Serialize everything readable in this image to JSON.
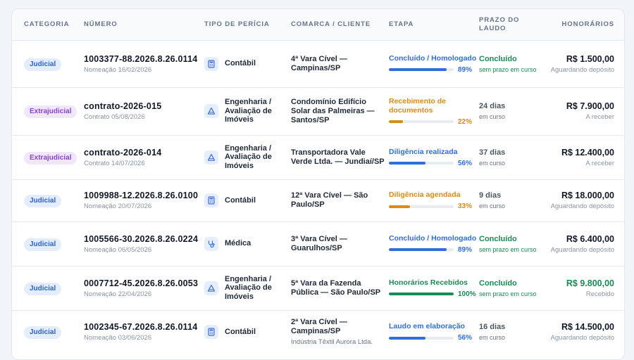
{
  "headers": {
    "categoria": "CATEGORIA",
    "numero": "NÚMERO",
    "tipo": "TIPO DE PERÍCIA",
    "comarca": "COMARCA / CLIENTE",
    "etapa": "ETAPA",
    "prazo_l1": "PRAZO DO",
    "prazo_l2": "LAUDO",
    "honorarios": "HONORÁRIOS"
  },
  "colors": {
    "blue": "#2f6fdc",
    "orange": "#dd8a15",
    "green": "#1a8a55",
    "gray": "#64748b",
    "bar_track": "#e8ecf1"
  },
  "rows": [
    {
      "categoria": "Judicial",
      "categoria_style": "judicial",
      "numero": "1003377-88.2026.8.26.0114",
      "sub": "Nomeação 16/02/2026",
      "tipo_icon": "calculator-icon",
      "tipo": "Contábil",
      "comarca": "4ª Vara Cível — Campinas/SP",
      "comarca_sub": "",
      "etapa": "Concluído / Homologado",
      "etapa_color": "blue",
      "progress": 89,
      "progress_label": "89%",
      "prazo": "Concluído",
      "prazo_sub": "sem prazo em curso",
      "prazo_style": "green",
      "valor": "R$ 1.500,00",
      "valor_sub": "Aguardando depósito",
      "valor_green": false
    },
    {
      "categoria": "Extrajudicial",
      "categoria_style": "extrajudicial",
      "numero": "contrato-2026-015",
      "sub": "Contrato 05/08/2026",
      "tipo_icon": "engineering-icon",
      "tipo": "Engenharia / Avaliação de Imóveis",
      "comarca": "Condomínio Edifício Solar das Palmeiras — Santos/SP",
      "comarca_sub": "",
      "etapa": "Recebimento de documentos",
      "etapa_color": "orange",
      "progress": 22,
      "progress_label": "22%",
      "prazo": "24 dias",
      "prazo_sub": "em curso",
      "prazo_style": "gray",
      "valor": "R$ 7.900,00",
      "valor_sub": "A receber",
      "valor_green": false
    },
    {
      "categoria": "Extrajudicial",
      "categoria_style": "extrajudicial",
      "numero": "contrato-2026-014",
      "sub": "Contrato 14/07/2026",
      "tipo_icon": "engineering-icon",
      "tipo": "Engenharia / Avaliação de Imóveis",
      "comarca": "Transportadora Vale Verde Ltda. — Jundiaí/SP",
      "comarca_sub": "",
      "etapa": "Diligência realizada",
      "etapa_color": "blue",
      "progress": 56,
      "progress_label": "56%",
      "prazo": "37 dias",
      "prazo_sub": "em curso",
      "prazo_style": "gray",
      "valor": "R$ 12.400,00",
      "valor_sub": "A receber",
      "valor_green": false
    },
    {
      "categoria": "Judicial",
      "categoria_style": "judicial",
      "numero": "1009988-12.2026.8.26.0100",
      "sub": "Nomeação 20/07/2026",
      "tipo_icon": "calculator-icon",
      "tipo": "Contábil",
      "comarca": "12ª Vara Cível — São Paulo/SP",
      "comarca_sub": "",
      "etapa": "Diligência agendada",
      "etapa_color": "orange",
      "progress": 33,
      "progress_label": "33%",
      "prazo": "9 dias",
      "prazo_sub": "em curso",
      "prazo_style": "gray",
      "valor": "R$ 18.000,00",
      "valor_sub": "Aguardando depósito",
      "valor_green": false
    },
    {
      "categoria": "Judicial",
      "categoria_style": "judicial",
      "numero": "1005566-30.2026.8.26.0224",
      "sub": "Nomeação 06/05/2026",
      "tipo_icon": "stethoscope-icon",
      "tipo": "Médica",
      "comarca": "3ª Vara Cível — Guarulhos/SP",
      "comarca_sub": "",
      "etapa": "Concluído / Homologado",
      "etapa_color": "blue",
      "progress": 89,
      "progress_label": "89%",
      "prazo": "Concluído",
      "prazo_sub": "sem prazo em curso",
      "prazo_style": "green",
      "valor": "R$ 6.400,00",
      "valor_sub": "Aguardando depósito",
      "valor_green": false
    },
    {
      "categoria": "Judicial",
      "categoria_style": "judicial",
      "numero": "0007712-45.2026.8.26.0053",
      "sub": "Nomeação 22/04/2026",
      "tipo_icon": "engineering-icon",
      "tipo": "Engenharia / Avaliação de Imóveis",
      "comarca": "5ª Vara da Fazenda Pública — São Paulo/SP",
      "comarca_sub": "",
      "etapa": "Honorários Recebidos",
      "etapa_color": "green",
      "progress": 100,
      "progress_label": "100%",
      "prazo": "Concluído",
      "prazo_sub": "sem prazo em curso",
      "prazo_style": "green",
      "valor": "R$ 9.800,00",
      "valor_sub": "Recebido",
      "valor_green": true
    },
    {
      "categoria": "Judicial",
      "categoria_style": "judicial",
      "numero": "1002345-67.2026.8.26.0114",
      "sub": "Nomeação 03/06/2026",
      "tipo_icon": "calculator-icon",
      "tipo": "Contábil",
      "comarca": "2ª Vara Cível — Campinas/SP",
      "comarca_sub": "Indústria Têxtil Aurora Ltda.",
      "etapa": "Laudo em elaboração",
      "etapa_color": "blue",
      "progress": 56,
      "progress_label": "56%",
      "prazo": "16 dias",
      "prazo_sub": "em curso",
      "prazo_style": "gray",
      "valor": "R$ 14.500,00",
      "valor_sub": "Aguardando depósito",
      "valor_green": false
    }
  ]
}
